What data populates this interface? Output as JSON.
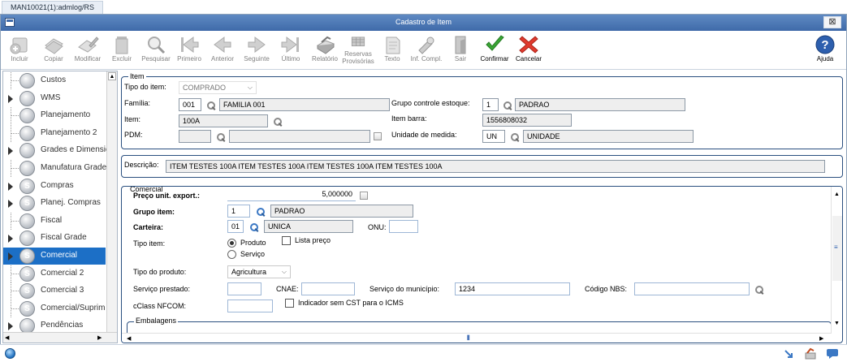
{
  "tab": {
    "label": "MAN10021(1):admlog/RS"
  },
  "window": {
    "title": "Cadastro de Item",
    "close_label": "⊠"
  },
  "toolbar": {
    "buttons": [
      {
        "label": "Incluir",
        "icon": "add-icon"
      },
      {
        "label": "Copiar",
        "icon": "copy-icon"
      },
      {
        "label": "Modificar",
        "icon": "edit-icon"
      },
      {
        "label": "Excluir",
        "icon": "trash-icon"
      },
      {
        "label": "Pesquisar",
        "icon": "search-icon"
      },
      {
        "label": "Primeiro",
        "icon": "first-icon"
      },
      {
        "label": "Anterior",
        "icon": "previous-icon"
      },
      {
        "label": "Seguinte",
        "icon": "next-icon"
      },
      {
        "label": "Último",
        "icon": "last-icon"
      },
      {
        "label": "Relatório",
        "icon": "printer-icon"
      },
      {
        "label": "Reservas",
        "label2": "Provisórias",
        "icon": "reserve-icon"
      },
      {
        "label": "Texto",
        "icon": "text-icon"
      },
      {
        "label": "Inf. Compl.",
        "icon": "tools-icon"
      },
      {
        "label": "Sair",
        "icon": "exit-icon"
      },
      {
        "label": "Confirmar",
        "icon": "confirm-icon"
      },
      {
        "label": "Cancelar",
        "icon": "cancel-icon"
      },
      {
        "label": "Ajuda",
        "icon": "help-icon"
      }
    ]
  },
  "sidebar": {
    "items": [
      {
        "label": "Custos",
        "glyph": ""
      },
      {
        "label": "WMS",
        "glyph": ""
      },
      {
        "label": "Planejamento",
        "glyph": ""
      },
      {
        "label": "Planejamento 2",
        "glyph": ""
      },
      {
        "label": "Grades e Dimensio",
        "glyph": ""
      },
      {
        "label": "Manufatura Grade",
        "glyph": ""
      },
      {
        "label": "Compras",
        "glyph": "S"
      },
      {
        "label": "Planej. Compras",
        "glyph": "S"
      },
      {
        "label": "Fiscal",
        "glyph": ""
      },
      {
        "label": "Fiscal Grade",
        "glyph": ""
      },
      {
        "label": "Comercial",
        "glyph": "S"
      },
      {
        "label": "Comercial 2",
        "glyph": "S"
      },
      {
        "label": "Comercial 3",
        "glyph": "S"
      },
      {
        "label": "Comercial/Suprim",
        "glyph": "S"
      },
      {
        "label": "Pendências",
        "glyph": ""
      }
    ]
  },
  "item_group": {
    "legend": "Item",
    "tipo_label": "Tipo do item:",
    "tipo_value": "COMPRADO",
    "familia_label": "Família:",
    "familia_code": "001",
    "familia_desc": "FAMILIA 001",
    "item_label": "Item:",
    "item_value": "100A",
    "pdm_label": "PDM:",
    "grupo_label": "Grupo controle estoque:",
    "grupo_code": "1",
    "grupo_desc": "PADRAO",
    "barra_label": "Item barra:",
    "barra_value": "1556808032",
    "unidade_label": "Unidade de medida:",
    "unidade_code": "UN",
    "unidade_desc": "UNIDADE"
  },
  "descricao": {
    "label": "Descrição:",
    "value": "ITEM TESTES 100A ITEM TESTES 100A ITEM TESTES 100A ITEM TESTES 100A"
  },
  "comercial": {
    "legend": "Comercial",
    "preco_label": "Preço unit. export.:",
    "preco_value": "5,000000",
    "grupo_item_label": "Grupo item:",
    "grupo_item_code": "1",
    "grupo_item_desc": "PADRAO",
    "carteira_label": "Carteira:",
    "carteira_code": "01",
    "carteira_desc": "UNICA",
    "onu_label": "ONU:",
    "tipo_item_label": "Tipo item:",
    "opt_produto": "Produto",
    "opt_servico": "Serviço",
    "lista_preco_label": "Lista preço",
    "tipo_produto_label": "Tipo do produto:",
    "tipo_produto_value": "Agricultura",
    "servico_prestado_label": "Serviço prestado:",
    "cnae_label": "CNAE:",
    "servico_municipio_label": "Serviço do município:",
    "servico_municipio_value": "1234",
    "nbs_label": "Código NBS:",
    "cclass_label": "cClass NFCOM:",
    "indicador_label": "Indicador sem CST para o ICMS",
    "embalagens_legend": "Embalagens"
  }
}
